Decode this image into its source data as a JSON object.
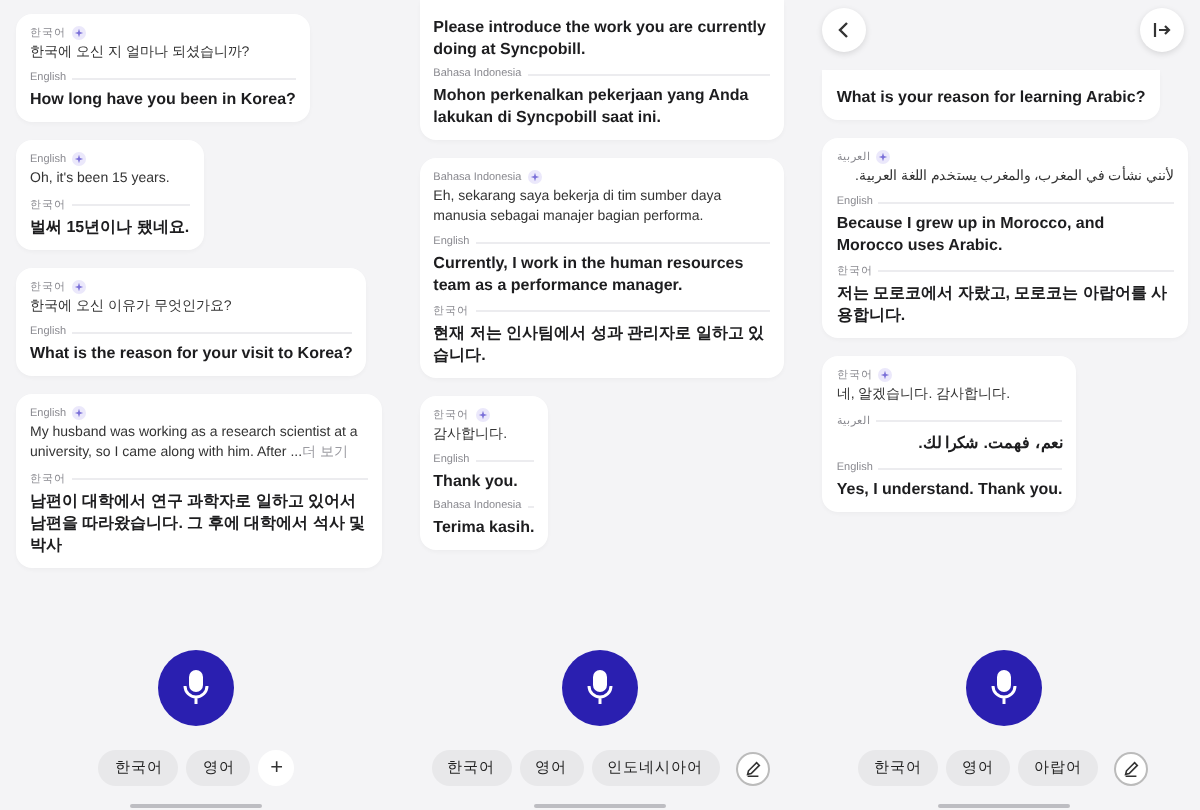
{
  "panels": [
    {
      "cards": [
        {
          "source": {
            "lang": "한국어",
            "text": "한국에 오신 지 얼마나 되셨습니까?"
          },
          "translations": [
            {
              "lang": "English",
              "text": "How long have you been in Korea?"
            }
          ]
        },
        {
          "source": {
            "lang": "English",
            "text": "Oh, it's been 15 years."
          },
          "translations": [
            {
              "lang": "한국어",
              "text": "벌써 15년이나 됐네요."
            }
          ]
        },
        {
          "source": {
            "lang": "한국어",
            "text": "한국에 오신 이유가 무엇인가요?"
          },
          "translations": [
            {
              "lang": "English",
              "text": "What is the reason for your visit to Korea?"
            }
          ]
        },
        {
          "source": {
            "lang": "English",
            "text": "My husband was working as a research scientist at a university, so I came along with him. After ...",
            "more": "더 보기"
          },
          "translations": [
            {
              "lang": "한국어",
              "text": "남편이 대학에서 연구 과학자로 일하고 있어서 남편을 따라왔습니다. 그 후에 대학에서 석사 및 박사"
            }
          ]
        }
      ],
      "chips": [
        "한국어",
        "영어"
      ],
      "action": {
        "kind": "add",
        "label": "+"
      }
    },
    {
      "cards": [
        {
          "translations": [
            {
              "text": "Please introduce the work you are currently doing at Syncpobill."
            },
            {
              "lang": "Bahasa Indonesia",
              "text": "Mohon perkenalkan pekerjaan yang Anda lakukan di Syncpobill saat ini."
            }
          ]
        },
        {
          "source": {
            "lang": "Bahasa Indonesia",
            "text": "Eh, sekarang saya bekerja di tim sumber daya manusia sebagai manajer bagian performa."
          },
          "translations": [
            {
              "lang": "English",
              "text": "Currently, I work in the human resources team as a performance manager."
            },
            {
              "lang": "한국어",
              "text": "현재 저는 인사팀에서 성과 관리자로 일하고 있습니다."
            }
          ]
        },
        {
          "source": {
            "lang": "한국어",
            "text": "감사합니다."
          },
          "translations": [
            {
              "lang": "English",
              "text": "Thank you."
            },
            {
              "lang": "Bahasa Indonesia",
              "text": "Terima kasih."
            }
          ]
        }
      ],
      "chips": [
        "한국어",
        "영어",
        "인도네시아어"
      ],
      "action": {
        "kind": "edit"
      }
    },
    {
      "top_bar": {
        "kind": "nav"
      },
      "cards": [
        {
          "translations": [
            {
              "text": "What is your reason for learning Arabic?"
            }
          ]
        },
        {
          "source": {
            "lang": "العربية",
            "text": "لأنني نشأت في المغرب، والمغرب يستخدم اللغة العربية."
          },
          "translations": [
            {
              "lang": "English",
              "text": "Because I grew up in Morocco, and Morocco uses Arabic."
            },
            {
              "lang": "한국어",
              "text": "저는 모로코에서 자랐고, 모로코는 아랍어를 사용합니다."
            }
          ]
        },
        {
          "source": {
            "lang": "한국어",
            "text": "네, 알겠습니다. 감사합니다."
          },
          "translations": [
            {
              "lang": "العربية",
              "text": "نعم، فهمت. شكرا لك."
            },
            {
              "lang": "English",
              "text": "Yes, I understand. Thank you."
            }
          ]
        }
      ],
      "chips": [
        "한국어",
        "영어",
        "아랍어"
      ],
      "action": {
        "kind": "edit"
      }
    }
  ]
}
